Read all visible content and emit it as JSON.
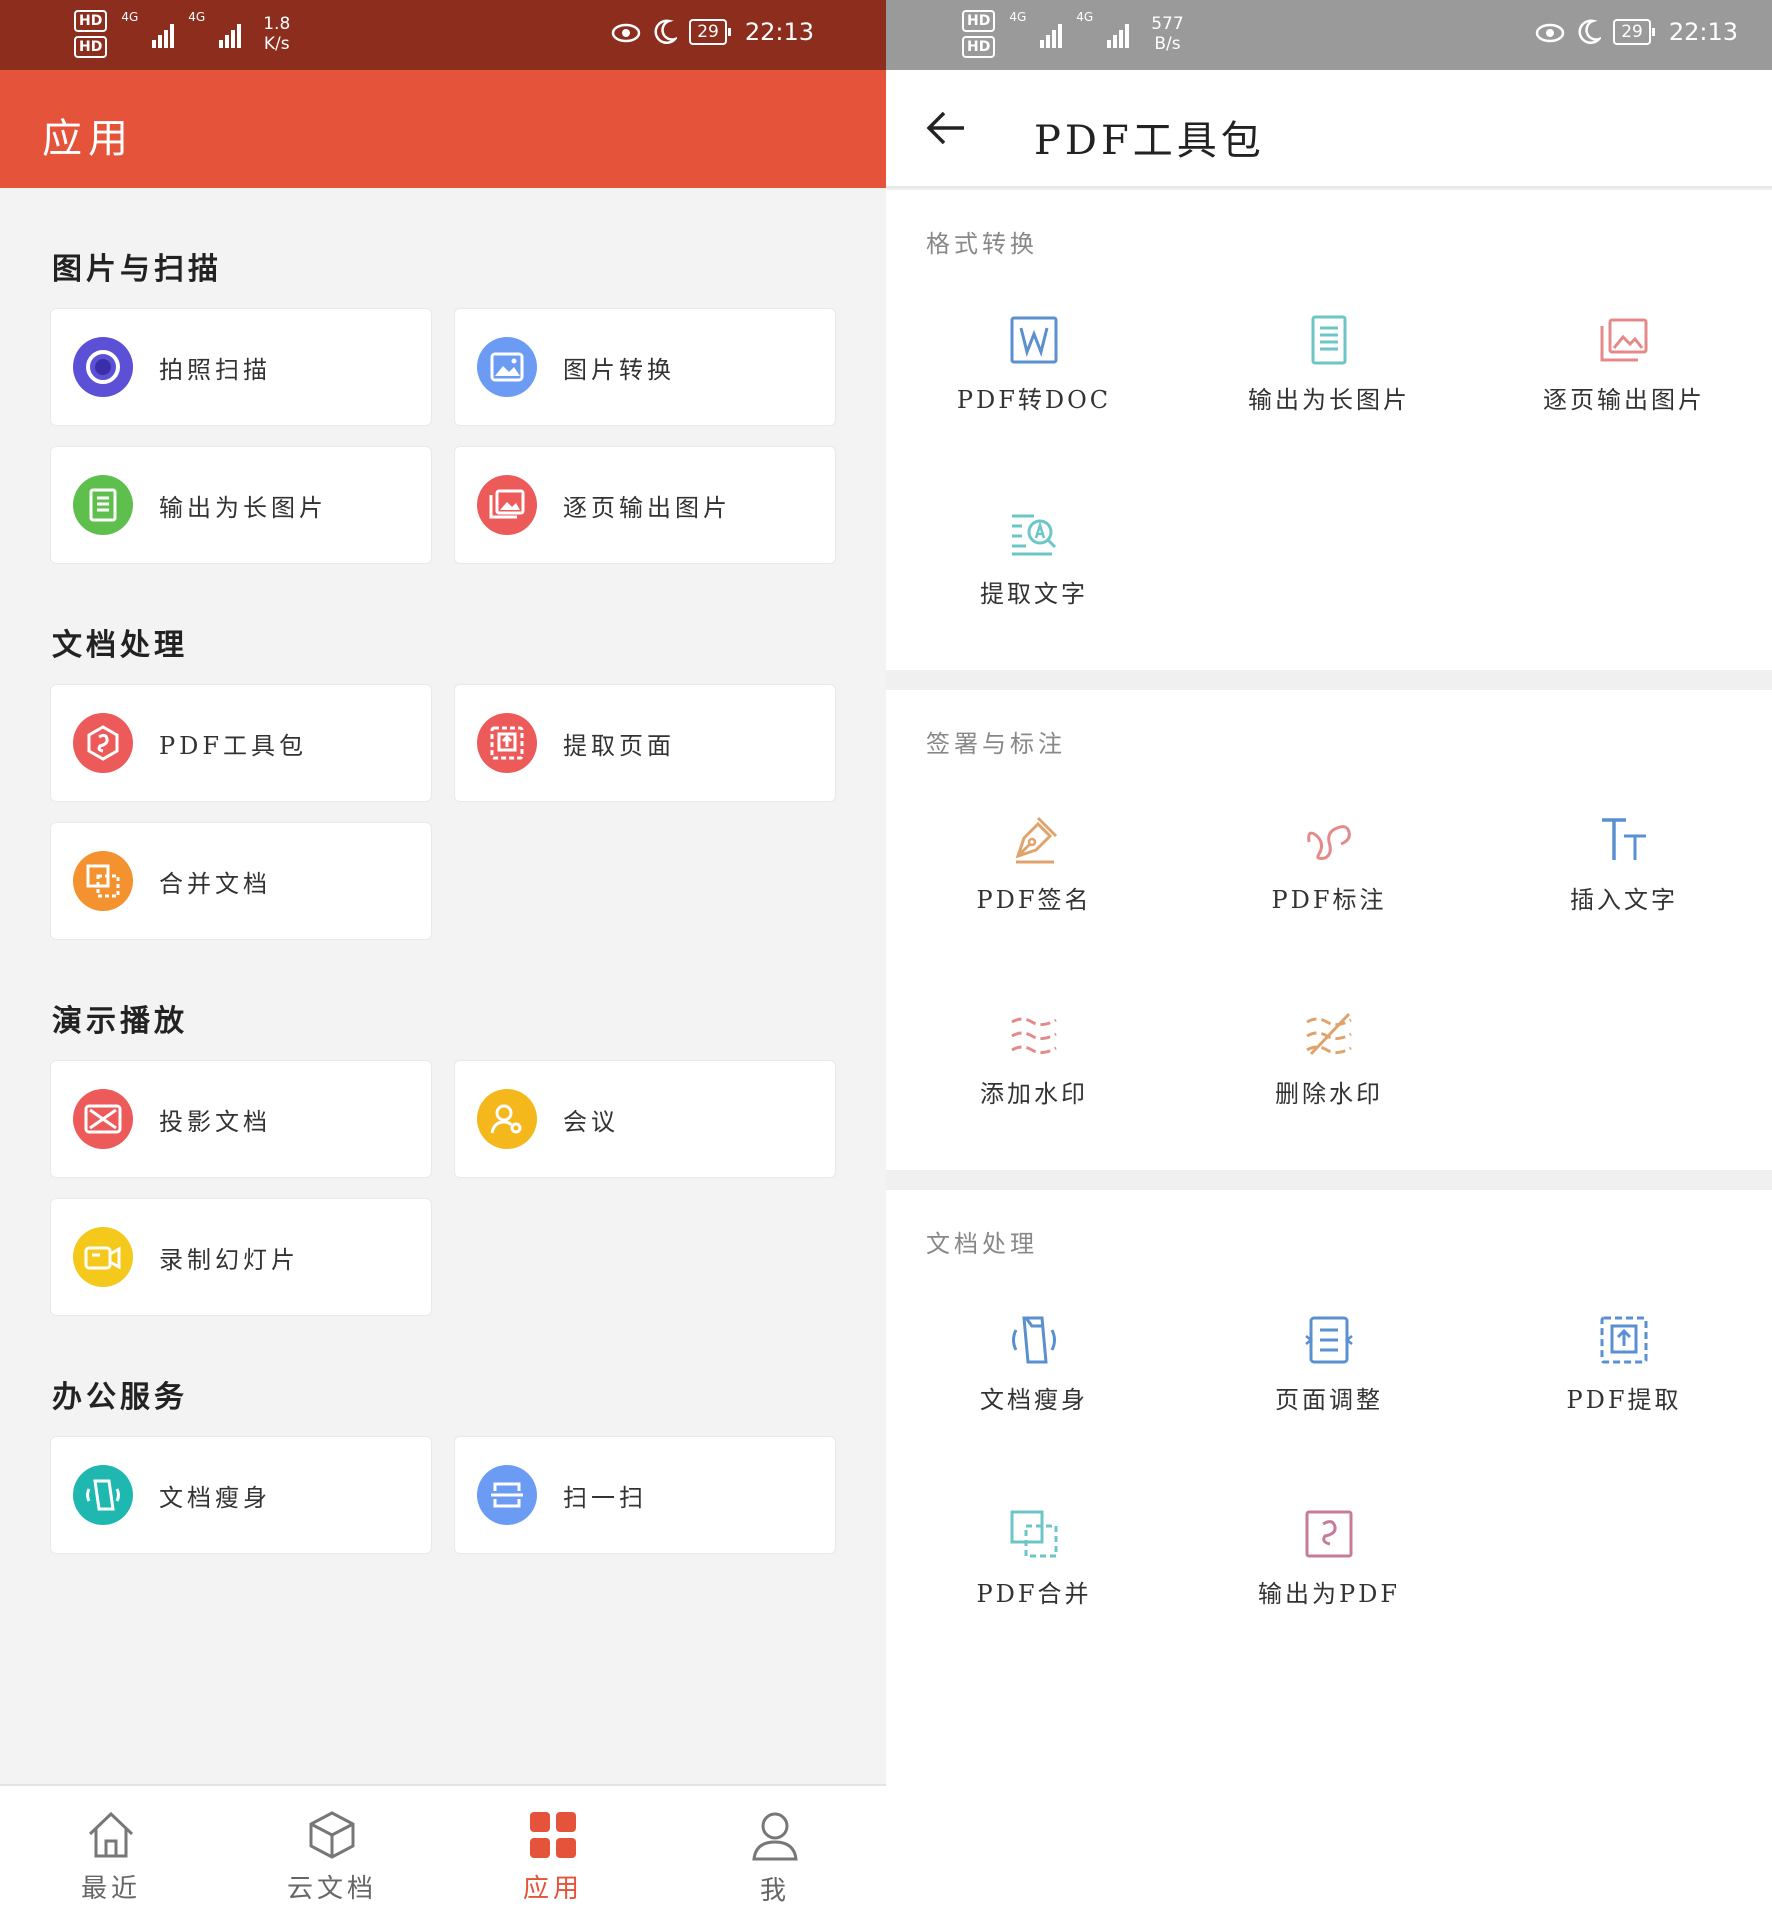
{
  "status_left": {
    "net1": "4G",
    "net2": "4G",
    "hd": "HD",
    "speed_value": "1.8",
    "speed_unit": "K/s",
    "time": "22:13",
    "battery": "29"
  },
  "status_right": {
    "net1": "4G",
    "net2": "4G",
    "hd": "HD",
    "speed_value": "577",
    "speed_unit": "B/s",
    "time": "22:13",
    "battery": "29"
  },
  "left": {
    "title": "应用",
    "sections": [
      {
        "title": "图片与扫描",
        "items": [
          {
            "label": "拍照扫描",
            "icon": "camera-scan-icon",
            "color": "#5b50d6"
          },
          {
            "label": "图片转换",
            "icon": "image-convert-icon",
            "color": "#6b9bf2"
          },
          {
            "label": "输出为长图片",
            "icon": "long-image-icon",
            "color": "#5fbf4d"
          },
          {
            "label": "逐页输出图片",
            "icon": "page-images-icon",
            "color": "#ec5a5a"
          }
        ]
      },
      {
        "title": "文档处理",
        "items": [
          {
            "label": "PDF工具包",
            "icon": "pdf-toolkit-icon",
            "color": "#ec5a5a"
          },
          {
            "label": "提取页面",
            "icon": "extract-page-icon",
            "color": "#ec5a5a"
          },
          {
            "label": "合并文档",
            "icon": "merge-doc-icon",
            "color": "#f3922e"
          }
        ]
      },
      {
        "title": "演示播放",
        "items": [
          {
            "label": "投影文档",
            "icon": "projection-icon",
            "color": "#ec5a5a"
          },
          {
            "label": "会议",
            "icon": "meeting-icon",
            "color": "#f5b81c"
          },
          {
            "label": "录制幻灯片",
            "icon": "record-slides-icon",
            "color": "#f5c81c"
          }
        ]
      },
      {
        "title": "办公服务",
        "items": [
          {
            "label": "文档瘦身",
            "icon": "slim-doc-icon",
            "color": "#1fb8b0"
          },
          {
            "label": "扫一扫",
            "icon": "scan-icon",
            "color": "#6b9bf2"
          }
        ]
      }
    ],
    "tabs": [
      {
        "label": "最近",
        "icon": "home-icon"
      },
      {
        "label": "云文档",
        "icon": "cloud-box-icon"
      },
      {
        "label": "应用",
        "icon": "apps-grid-icon"
      },
      {
        "label": "我",
        "icon": "user-icon"
      }
    ],
    "active_tab": "应用",
    "accent": "#e5533a"
  },
  "right": {
    "title": "PDF工具包",
    "groups": [
      {
        "title": "格式转换",
        "items": [
          {
            "label": "PDF转DOC",
            "icon": "pdf-to-doc-icon",
            "color": "#5a8fd0"
          },
          {
            "label": "输出为长图片",
            "icon": "long-image-icon",
            "color": "#6cc6c8"
          },
          {
            "label": "逐页输出图片",
            "icon": "page-images-icon",
            "color": "#e48a8a"
          },
          {
            "label": "提取文字",
            "icon": "extract-text-icon",
            "color": "#6cc6c8"
          }
        ]
      },
      {
        "title": "签署与标注",
        "items": [
          {
            "label": "PDF签名",
            "icon": "signature-pen-icon",
            "color": "#e0a36b"
          },
          {
            "label": "PDF标注",
            "icon": "annotate-icon",
            "color": "#e48a8a"
          },
          {
            "label": "插入文字",
            "icon": "insert-text-icon",
            "color": "#5a8fd0"
          },
          {
            "label": "添加水印",
            "icon": "add-watermark-icon",
            "color": "#e48a8a"
          },
          {
            "label": "删除水印",
            "icon": "remove-watermark-icon",
            "color": "#e0a36b"
          }
        ]
      },
      {
        "title": "文档处理",
        "items": [
          {
            "label": "文档瘦身",
            "icon": "slim-doc-icon",
            "color": "#5a8fd0"
          },
          {
            "label": "页面调整",
            "icon": "page-adjust-icon",
            "color": "#5a8fd0"
          },
          {
            "label": "PDF提取",
            "icon": "pdf-extract-icon",
            "color": "#5a8fd0"
          },
          {
            "label": "PDF合并",
            "icon": "pdf-merge-icon",
            "color": "#6cc6c8"
          },
          {
            "label": "输出为PDF",
            "icon": "export-pdf-icon",
            "color": "#c87a9a"
          }
        ]
      }
    ]
  }
}
